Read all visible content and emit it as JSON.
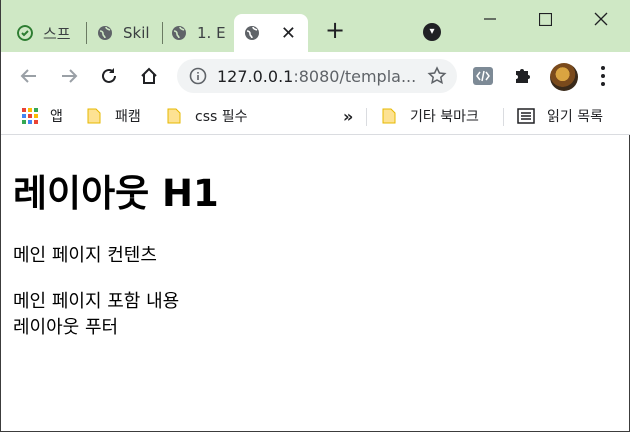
{
  "tabs": [
    {
      "label": "스프",
      "active": false
    },
    {
      "label": "Skil",
      "active": false
    },
    {
      "label": "1. E",
      "active": false
    },
    {
      "label": "",
      "active": true
    }
  ],
  "address_bar": {
    "host": "127.0.0.1",
    "rest": ":8080/templa..."
  },
  "bookmarks": {
    "apps_label": "앱",
    "items": [
      "패캠",
      "css 필수"
    ],
    "overflow": "»",
    "other": "기타 북마크",
    "reading_list": "읽기 목록"
  },
  "page": {
    "heading": "레이아웃 H1",
    "content": "메인 페이지 컨텐츠",
    "included": "메인 페이지 포함 내용",
    "footer": "레이아웃 푸터"
  },
  "colors": {
    "tabstrip": "#cfe8c5",
    "omnibox": "#f1f3f4"
  }
}
